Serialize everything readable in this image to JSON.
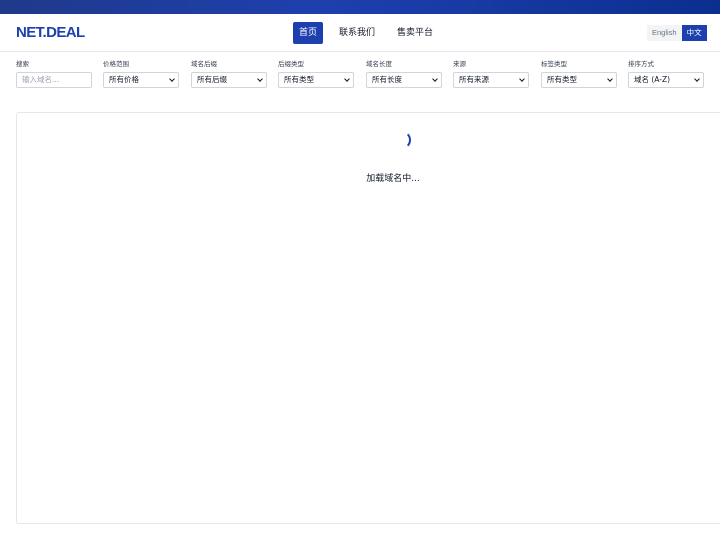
{
  "header": {
    "logo": "NET.DEAL",
    "nav": [
      {
        "label": "首页",
        "active": true
      },
      {
        "label": "联系我们",
        "active": false
      },
      {
        "label": "售卖平台",
        "active": false
      }
    ],
    "languages": [
      {
        "label": "English",
        "active": false
      },
      {
        "label": "中文",
        "active": true
      }
    ]
  },
  "filters": {
    "search": {
      "label": "搜索",
      "placeholder": "输入域名..."
    },
    "price": {
      "label": "价格范围",
      "value": "所有价格"
    },
    "suffix": {
      "label": "域名后缀",
      "value": "所有后缀"
    },
    "suffix_type": {
      "label": "后缀类型",
      "value": "所有类型"
    },
    "length": {
      "label": "域名长度",
      "value": "所有长度"
    },
    "source": {
      "label": "来源",
      "value": "所有来源"
    },
    "tag_type": {
      "label": "标签类型",
      "value": "所有类型"
    },
    "sort": {
      "label": "排序方式",
      "value": "域名 (A-Z)"
    }
  },
  "content": {
    "loading_text": "加载域名中..."
  },
  "colors": {
    "brand": "#1e40af",
    "border": "#e5e7eb"
  }
}
